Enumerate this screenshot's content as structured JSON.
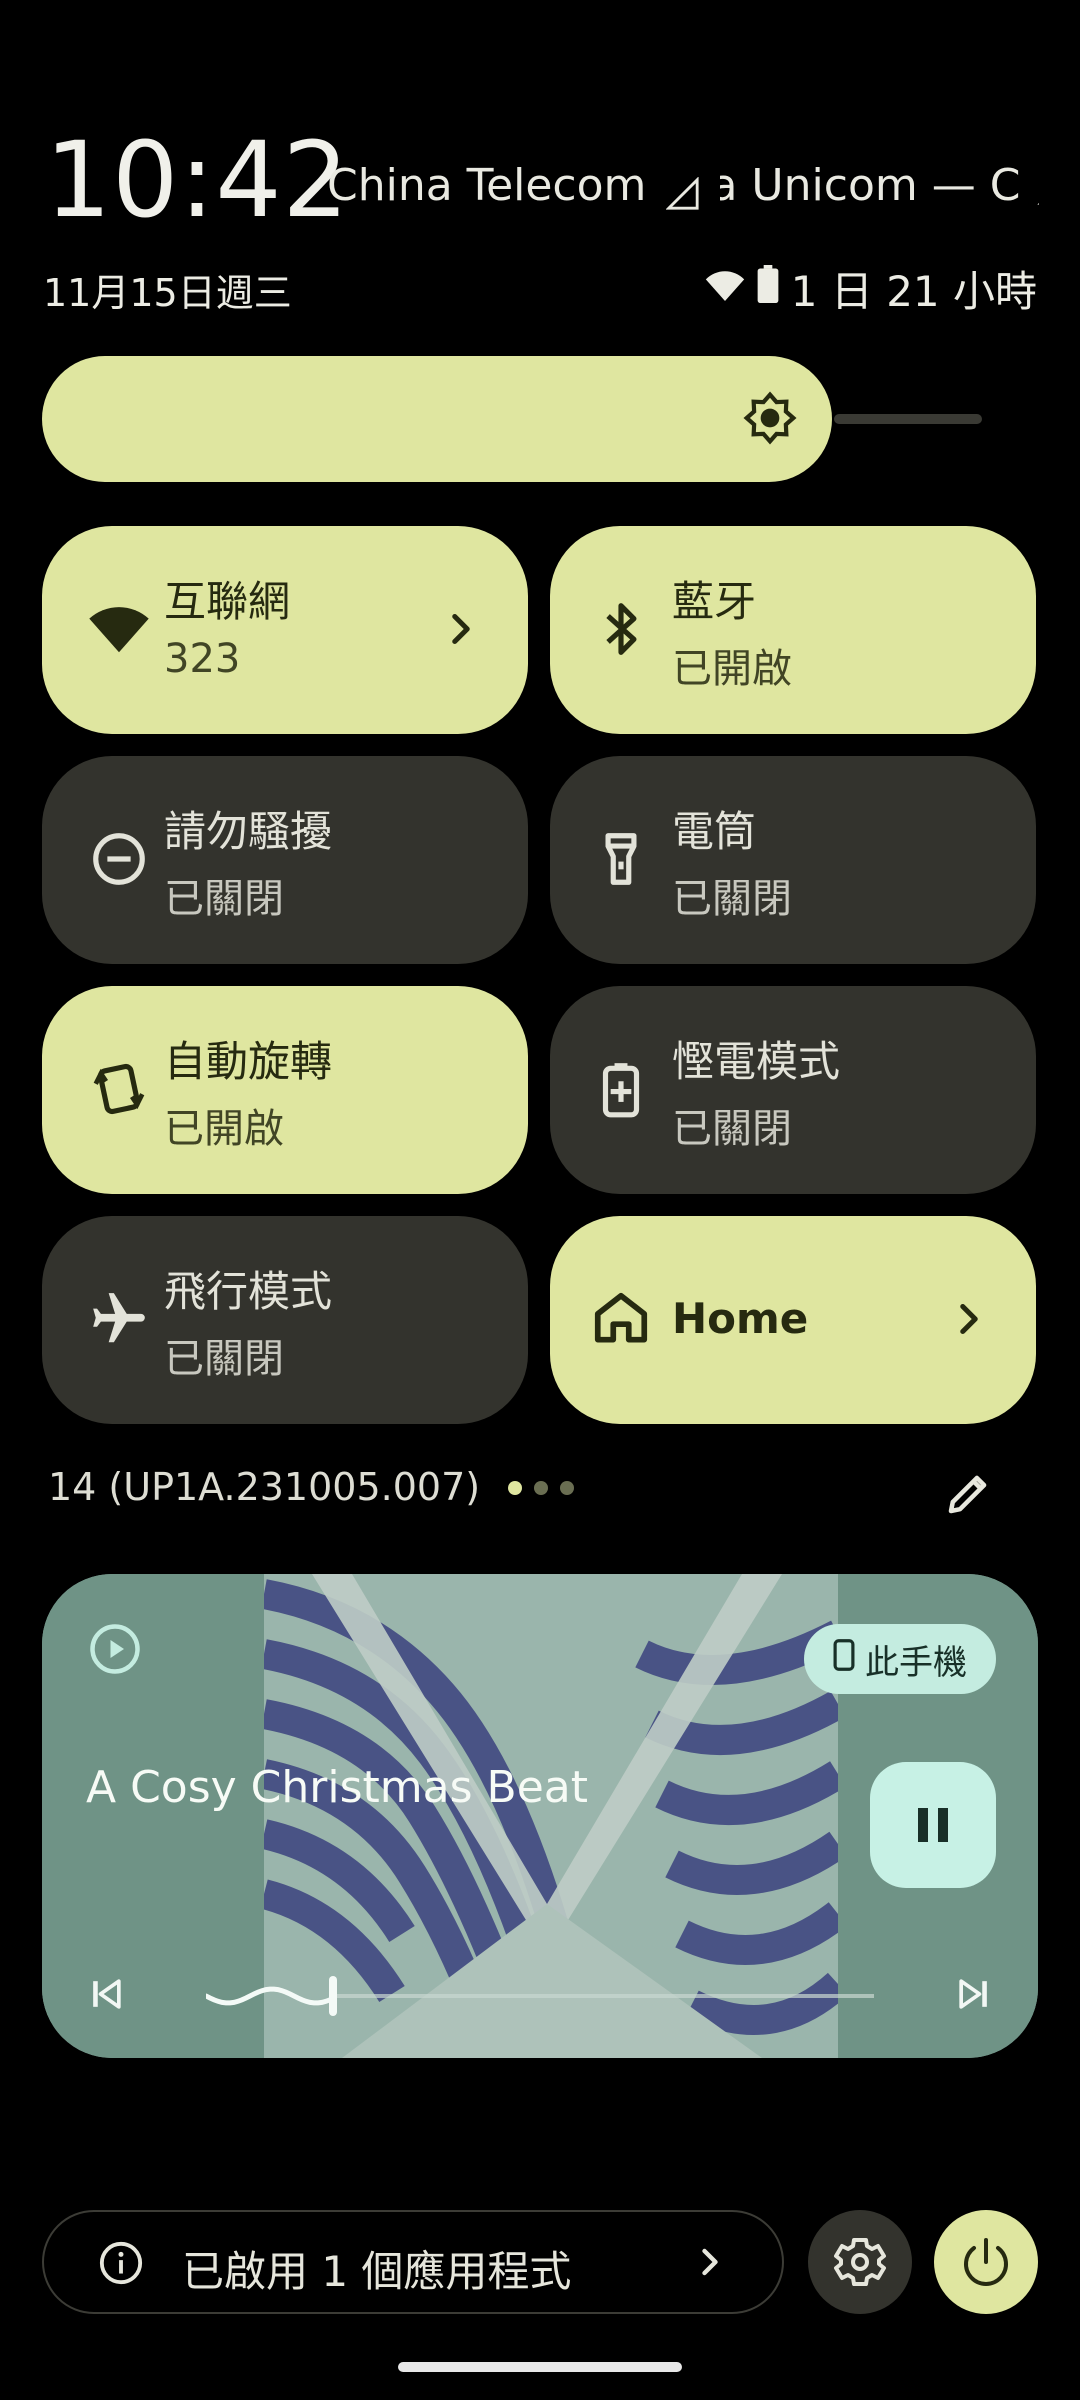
{
  "status": {
    "clock": "10:42",
    "carrier1": "China Telecom",
    "carrier2": "China Unicom — C",
    "date": "11月15日週三",
    "battery": "1 日 21 小時"
  },
  "tiles": {
    "internet": {
      "title": "互聯網",
      "subtitle": "323",
      "state": "on"
    },
    "bluetooth": {
      "title": "藍牙",
      "subtitle": "已開啟",
      "state": "on"
    },
    "dnd": {
      "title": "請勿騷擾",
      "subtitle": "已關閉",
      "state": "off"
    },
    "flashlight": {
      "title": "電筒",
      "subtitle": "已關閉",
      "state": "off"
    },
    "autorotate": {
      "title": "自動旋轉",
      "subtitle": "已開啟",
      "state": "on"
    },
    "battery_saver": {
      "title": "慳電模式",
      "subtitle": "已關閉",
      "state": "off"
    },
    "airplane": {
      "title": "飛行模式",
      "subtitle": "已關閉",
      "state": "off"
    },
    "home": {
      "title": "Home",
      "state": "on"
    }
  },
  "brightness": {
    "level": 0.84
  },
  "build": {
    "version": "14 (UP1A.231005.007)",
    "page": 1,
    "pages": 3
  },
  "media": {
    "title": "A Cosy Christmas Beat",
    "device": "此手機",
    "progress": 0.19
  },
  "footer": {
    "apps_active": "已啟用 1 個應用程式"
  },
  "colors": {
    "accent_on": "#dfe6a0",
    "tile_off": "#33332d",
    "media_chip": "#c4ece0"
  }
}
